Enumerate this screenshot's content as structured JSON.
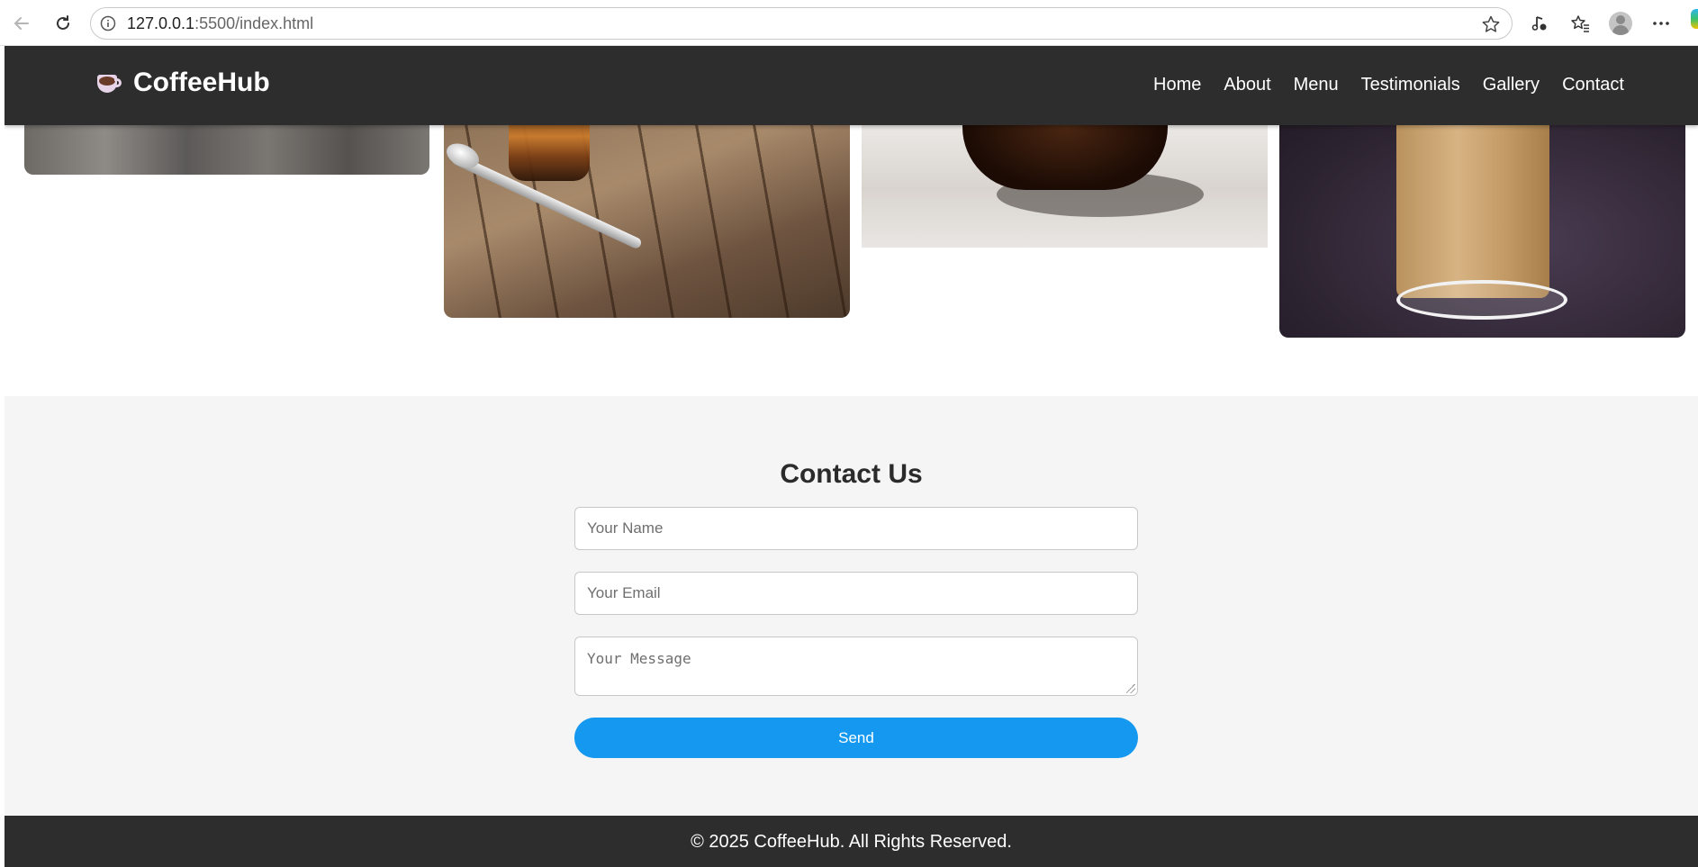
{
  "browser": {
    "url_host": "127.0.0.1",
    "url_path": ":5500/index.html"
  },
  "header": {
    "logo_icon": "coffee-cup-icon",
    "brand": "CoffeeHub",
    "nav": [
      "Home",
      "About",
      "Menu",
      "Testimonials",
      "Gallery",
      "Contact"
    ]
  },
  "contact": {
    "title": "Contact Us",
    "name_placeholder": "Your Name",
    "email_placeholder": "Your Email",
    "message_placeholder": "Your Message",
    "send_label": "Send"
  },
  "footer": {
    "text": "© 2025 CoffeeHub. All Rights Reserved."
  },
  "colors": {
    "header_bg": "#2d2d2d",
    "accent": "#1599f0",
    "contact_bg": "#f5f5f5"
  }
}
